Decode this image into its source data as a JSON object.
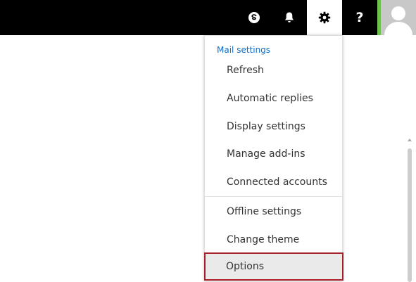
{
  "header": {
    "icons": [
      "skype-icon",
      "bell-icon",
      "gear-icon",
      "help-icon",
      "avatar"
    ],
    "help_glyph": "?",
    "active_color": "#ffffff",
    "bar_color": "#000000",
    "avatar_accent": "#6cc24a"
  },
  "menu": {
    "header": "Mail settings",
    "items": [
      {
        "label": "Refresh"
      },
      {
        "label": "Automatic replies"
      },
      {
        "label": "Display settings"
      },
      {
        "label": "Manage add-ins"
      },
      {
        "label": "Connected accounts"
      },
      {
        "label": "Offline settings"
      },
      {
        "label": "Change theme"
      },
      {
        "label": "Options"
      }
    ],
    "selected": "Options",
    "header_color": "#0f6fc6",
    "highlight_border": "#a8202a"
  }
}
